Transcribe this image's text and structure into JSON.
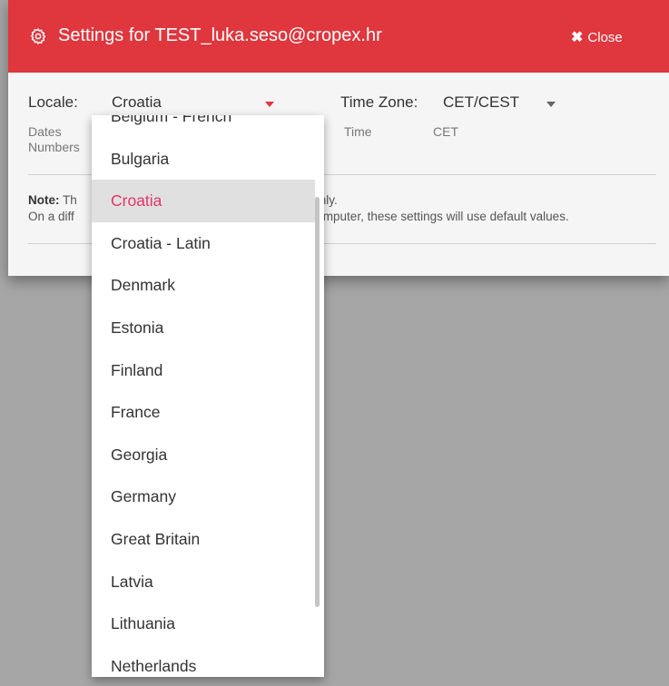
{
  "header": {
    "title": "Settings for TEST_luka.seso@cropex.hr",
    "close_label": "Close",
    "color": "#e0363d"
  },
  "locale": {
    "label": "Locale:",
    "value": "Croatia",
    "dates_label": "Dates",
    "numbers_label": "Numbers"
  },
  "timezone": {
    "label": "Time Zone:",
    "value": "CET/CEST",
    "time_label": "Time",
    "time_value": "CET"
  },
  "note": {
    "bold": "Note:",
    "line1_start": "Th",
    "line1_end": "ser, only.",
    "line2_start": "On a diff",
    "line2_end": "mputer, these settings will use default values."
  },
  "dropdown": {
    "items": [
      "Belgium - French",
      "Bulgaria",
      "Croatia",
      "Croatia - Latin",
      "Denmark",
      "Estonia",
      "Finland",
      "France",
      "Georgia",
      "Germany",
      "Great Britain",
      "Latvia",
      "Lithuania",
      "Netherlands"
    ],
    "selected": "Croatia",
    "selected_color": "#e0366a"
  }
}
